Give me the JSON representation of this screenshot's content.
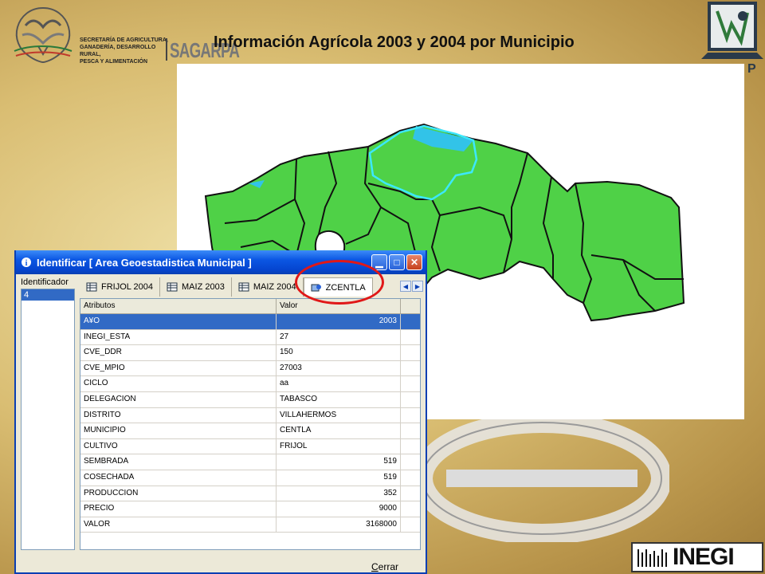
{
  "slide": {
    "title": "Información Agrícola  2003 y 2004 por Municipio"
  },
  "logos": {
    "sagarpa_text": [
      "SECRETARÍA DE AGRICULTURA,",
      "GANADERÍA, DESARROLLO RURAL,",
      "PESCA Y ALIMENTACIÓN"
    ],
    "sagarpa_word": "SAGARPA",
    "corner_letter": "P",
    "inegi_word": "INEGI"
  },
  "dialog": {
    "title": "Identificar [ Area Geoestadistica Municipal ]",
    "identifier_label": "Identificador",
    "identifier_items": [
      "4"
    ],
    "tabs": [
      {
        "label": "FRIJOL 2004",
        "icon": "table-icon"
      },
      {
        "label": "MAIZ 2003",
        "icon": "table-icon"
      },
      {
        "label": "MAIZ 2004",
        "icon": "table-icon"
      },
      {
        "label": "ZCENTLA",
        "icon": "layer-icon"
      }
    ],
    "columns": [
      "Atributos",
      "Valor"
    ],
    "rows": [
      {
        "attr": "A¥O",
        "value": "2003",
        "numeric": true,
        "selected": true
      },
      {
        "attr": "INEGI_ESTA",
        "value": "27",
        "numeric": false
      },
      {
        "attr": "CVE_DDR",
        "value": "150",
        "numeric": false
      },
      {
        "attr": "CVE_MPIO",
        "value": "27003",
        "numeric": false
      },
      {
        "attr": "CICLO",
        "value": "aa",
        "numeric": false
      },
      {
        "attr": "DELEGACION",
        "value": "TABASCO",
        "numeric": false
      },
      {
        "attr": "DISTRITO",
        "value": "VILLAHERMOS",
        "numeric": false
      },
      {
        "attr": "MUNICIPIO",
        "value": "CENTLA",
        "numeric": false
      },
      {
        "attr": "CULTIVO",
        "value": "FRIJOL",
        "numeric": false
      },
      {
        "attr": "SEMBRADA",
        "value": "519",
        "numeric": true
      },
      {
        "attr": "COSECHADA",
        "value": "519",
        "numeric": true
      },
      {
        "attr": "PRODUCCION",
        "value": "352",
        "numeric": true
      },
      {
        "attr": "PRECIO",
        "value": "9000",
        "numeric": true
      },
      {
        "attr": "VALOR",
        "value": "3168000",
        "numeric": true
      }
    ],
    "close_button": {
      "accel": "C",
      "rest": "errar"
    }
  },
  "colors": {
    "map_green": "#4fd147",
    "boundary_cyan": "#3ce8ff",
    "highlight_red": "#e01818",
    "selection_blue": "#316ac5"
  }
}
